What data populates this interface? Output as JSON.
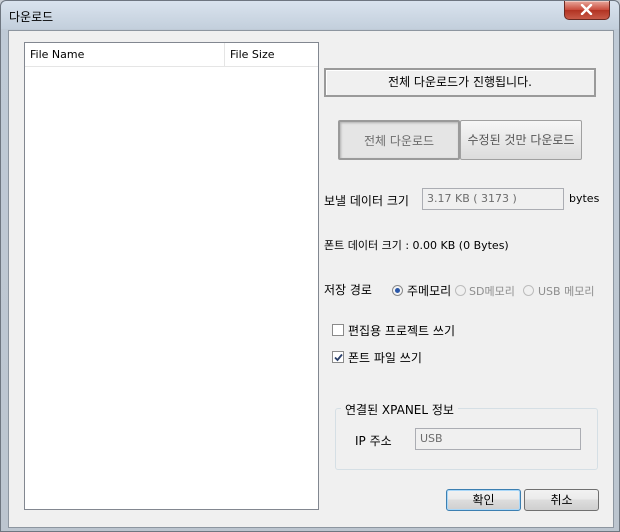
{
  "window": {
    "title": "다운로드"
  },
  "file_list": {
    "columns": [
      "File Name",
      "File Size"
    ],
    "rows": []
  },
  "status_message": "전체 다운로드가 진행됩니다.",
  "mode_buttons": {
    "full_download": "전체 다운로드",
    "modified_only": "수정된 것만 다운로드"
  },
  "send_data": {
    "label": "보낼 데이터 크기",
    "value": "3.17 KB ( 3173 )",
    "unit": "bytes"
  },
  "font_data": {
    "label": "폰트 데이터 크기 : 0.00 KB (0 Bytes)"
  },
  "storage": {
    "label": "저장 경로",
    "options": [
      {
        "label": "주메모리",
        "selected": true,
        "enabled": true
      },
      {
        "label": "SD메모리",
        "selected": false,
        "enabled": false
      },
      {
        "label": "USB 메모리",
        "selected": false,
        "enabled": false
      }
    ]
  },
  "options": {
    "write_edit_project": {
      "label": "편집용 프로젝트 쓰기",
      "checked": false
    },
    "write_font_file": {
      "label": "폰트 파일 쓰기",
      "checked": true
    }
  },
  "xpanel": {
    "group_label": "연결된 XPANEL 정보",
    "ip_label": "IP 주소",
    "ip_value": "USB"
  },
  "buttons": {
    "ok": "확인",
    "cancel": "취소"
  }
}
